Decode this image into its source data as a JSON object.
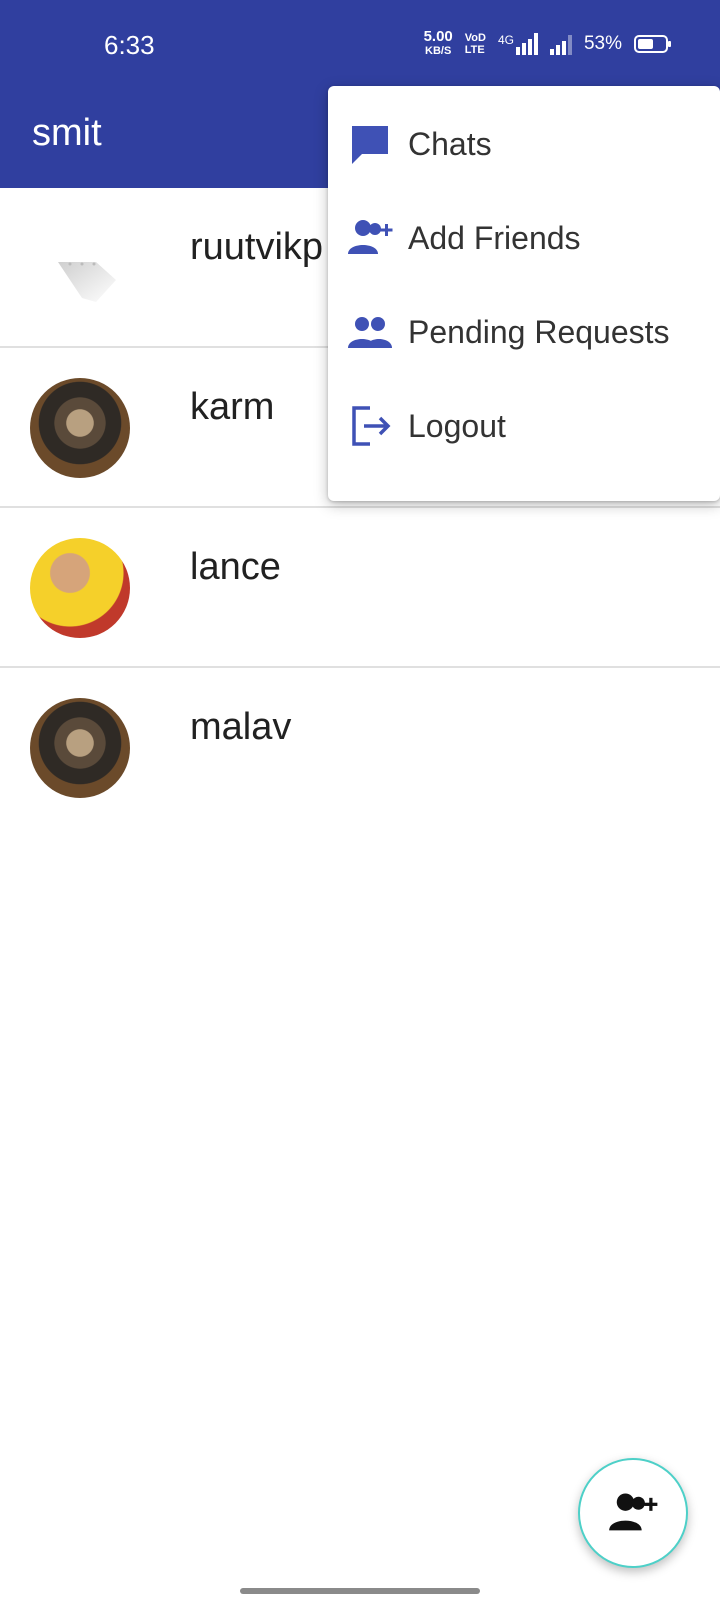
{
  "status_bar": {
    "time": "6:33",
    "net_speed": "5.00",
    "net_speed_unit": "KB/S",
    "volte_top": "VoD",
    "volte_bottom": "LTE",
    "network": "4G",
    "battery": "53%"
  },
  "app_bar": {
    "title": "smit"
  },
  "chats": [
    {
      "name": "ruutvikp",
      "avatar": "broken-image-icon"
    },
    {
      "name": "karm",
      "avatar": "user-photo"
    },
    {
      "name": "lance",
      "avatar": "user-photo"
    },
    {
      "name": "malav",
      "avatar": "user-photo"
    }
  ],
  "menu": {
    "items": [
      {
        "label": "Chats",
        "icon": "chat-icon"
      },
      {
        "label": "Add Friends",
        "icon": "add-friend-icon"
      },
      {
        "label": "Pending Requests",
        "icon": "people-icon"
      },
      {
        "label": "Logout",
        "icon": "logout-icon"
      }
    ]
  },
  "fab": {
    "icon": "add-friend-icon"
  },
  "colors": {
    "primary": "#303f9f",
    "icon": "#3f51b5",
    "fab_border": "#4dd0c8"
  }
}
